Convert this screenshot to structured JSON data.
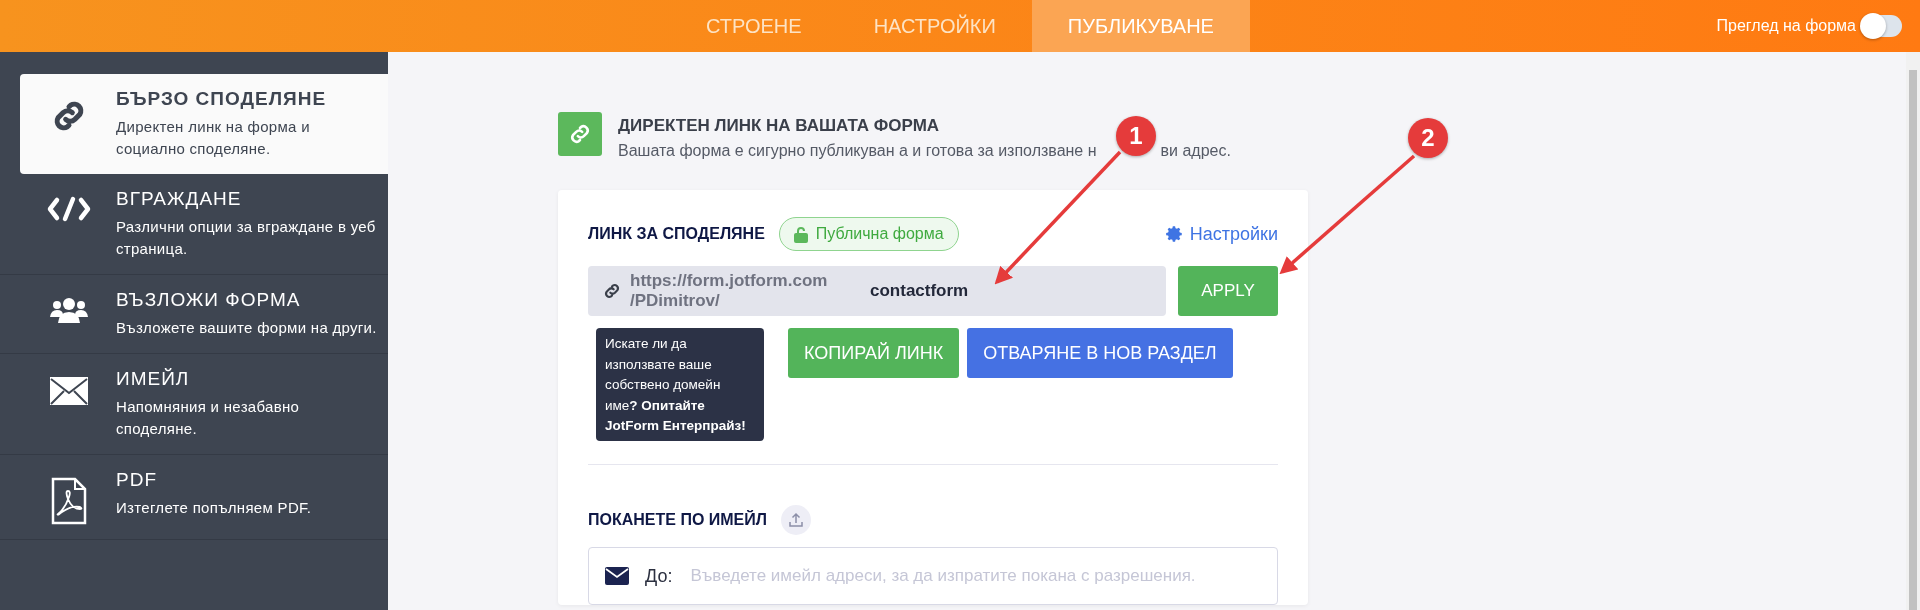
{
  "header": {
    "tabs": [
      {
        "label": "СТРОЕНЕ",
        "selected": false
      },
      {
        "label": "НАСТРОЙКИ",
        "selected": false
      },
      {
        "label": "ПУБЛИКУВАНЕ",
        "selected": true
      }
    ],
    "preview": {
      "label": "Преглед на форма",
      "on": false
    }
  },
  "sidebar": {
    "items": [
      {
        "kind": "link",
        "title": "БЪРЗО СПОДЕЛЯНЕ",
        "desc": "Директен линк на форма и социално споделяне.",
        "selected": true
      },
      {
        "kind": "code",
        "title": "ВГРАЖДАНЕ",
        "desc": "Различни опции за вграждане в уеб страница.",
        "selected": false
      },
      {
        "kind": "users",
        "title": "ВЪЗЛОЖИ ФОРМА",
        "desc": "Възложете вашите форми на други.",
        "selected": false
      },
      {
        "kind": "mail",
        "title": "ИМЕЙЛ",
        "desc": "Напомняния и незабавно споделяне.",
        "selected": false
      },
      {
        "kind": "pdf",
        "title": "PDF",
        "desc": "Изтеглете попълняем PDF.",
        "selected": false
      }
    ]
  },
  "section": {
    "title": "ДИРЕКТЕН ЛИНК НА ВАШАТА ФОРМА",
    "subtitle_parts": [
      "Вашата форма е сигурно публикуван а и готова за използване н",
      "ви адрес."
    ]
  },
  "share": {
    "label": "ЛИНК ЗА СПОДЕЛЯНЕ",
    "badge": "Публична форма",
    "settings": "Настройки",
    "prefix_lines": [
      "https://form.jotform.com",
      "/PDimitrov/"
    ],
    "value": "contactform",
    "apply": "APPLY",
    "tooltip": "Искате ли да използвате ваше собствено домейн име**? Опитайте JotForm Ентерпрайз!**",
    "copy": "КОПИРАЙ ЛИНК",
    "open": "ОТВАРЯНЕ В НОВ РАЗДЕЛ"
  },
  "invite": {
    "label": "ПОКАНЕТЕ ПО ИМЕЙЛ",
    "to": "До:",
    "placeholder": "Въведете имейл адреси, за да изпратите покана с разрешения."
  },
  "annotations": [
    {
      "number": "1"
    },
    {
      "number": "2"
    }
  ]
}
